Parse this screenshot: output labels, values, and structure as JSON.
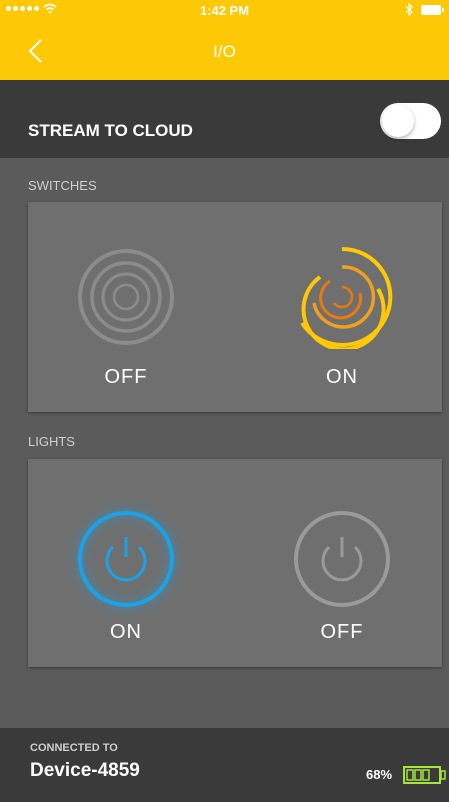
{
  "status_bar": {
    "time": "1:42 PM",
    "signal_icon": "signal-dots-icon",
    "wifi_icon": "wifi-icon",
    "bluetooth_icon": "bluetooth-icon",
    "battery_icon": "battery-icon"
  },
  "nav": {
    "title": "I/O",
    "back_icon": "chevron-left-icon"
  },
  "stream": {
    "label": "STREAM TO CLOUD",
    "enabled": false
  },
  "switches": {
    "section_label": "SWITCHES",
    "items": [
      {
        "label": "OFF",
        "state": "off",
        "icon": "concentric-circles-icon"
      },
      {
        "label": "ON",
        "state": "on",
        "icon": "concentric-circles-icon"
      }
    ]
  },
  "lights": {
    "section_label": "LIGHTS",
    "items": [
      {
        "label": "ON",
        "state": "on",
        "icon": "power-icon"
      },
      {
        "label": "OFF",
        "state": "off",
        "icon": "power-icon"
      }
    ]
  },
  "footer": {
    "connected_label": "CONNECTED TO",
    "device_name": "Device-4859",
    "battery_percent": "68%",
    "battery_level": 0.68
  },
  "colors": {
    "accent_yellow": "#fdc806",
    "switch_on_orange": "#f0a020",
    "light_on_blue": "#1aa3e8",
    "battery_green": "#a3e635",
    "dark_bar": "#3a3a3a",
    "panel": "#6f6f6f",
    "background": "#5b5b5b"
  }
}
